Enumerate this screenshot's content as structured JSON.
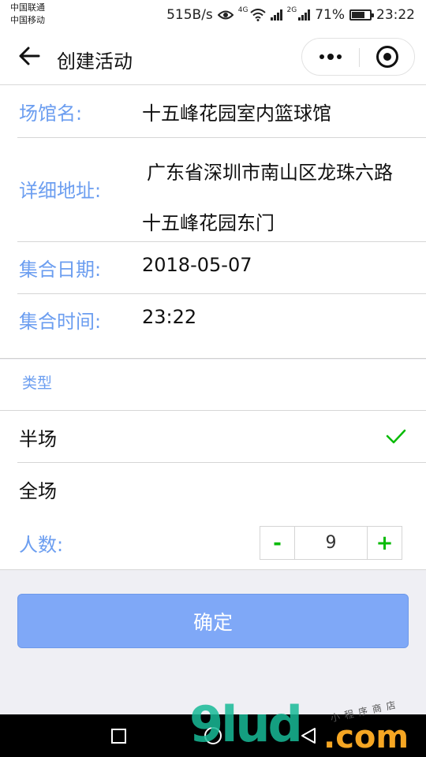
{
  "status_bar": {
    "carrier1": "中国联通",
    "carrier2": "中国移动",
    "speed": "515B/s",
    "net1": "4G",
    "net2": "2G",
    "battery": "71%",
    "battery_level": 0.71,
    "time": "23:22"
  },
  "nav": {
    "title": "创建活动",
    "back_icon": "arrow-left-icon",
    "more_icon": "more-dots-icon",
    "close_icon": "target-circle-icon"
  },
  "form": {
    "venue_label": "场馆名:",
    "venue_value": "十五峰花园室内篮球馆",
    "address_label": "详细地址:",
    "address_value": "广东省深圳市南山区龙珠六路十五峰花园东门",
    "date_label": "集合日期:",
    "date_value": "2018-05-07",
    "time_label": "集合时间:",
    "time_value": "23:22"
  },
  "type_section": {
    "heading": "类型",
    "options": [
      {
        "label": "半场",
        "selected": true
      },
      {
        "label": "全场",
        "selected": false
      }
    ]
  },
  "count": {
    "label": "人数:",
    "minus": "-",
    "value": "9",
    "plus": "+"
  },
  "confirm_label": "确定",
  "colors": {
    "label_blue": "#6c9ef0",
    "button_blue": "#7fa8f7",
    "accent_green": "#09bb07"
  },
  "watermark": {
    "main": "9lud",
    "domain": ".com",
    "small": "小程序商店"
  }
}
